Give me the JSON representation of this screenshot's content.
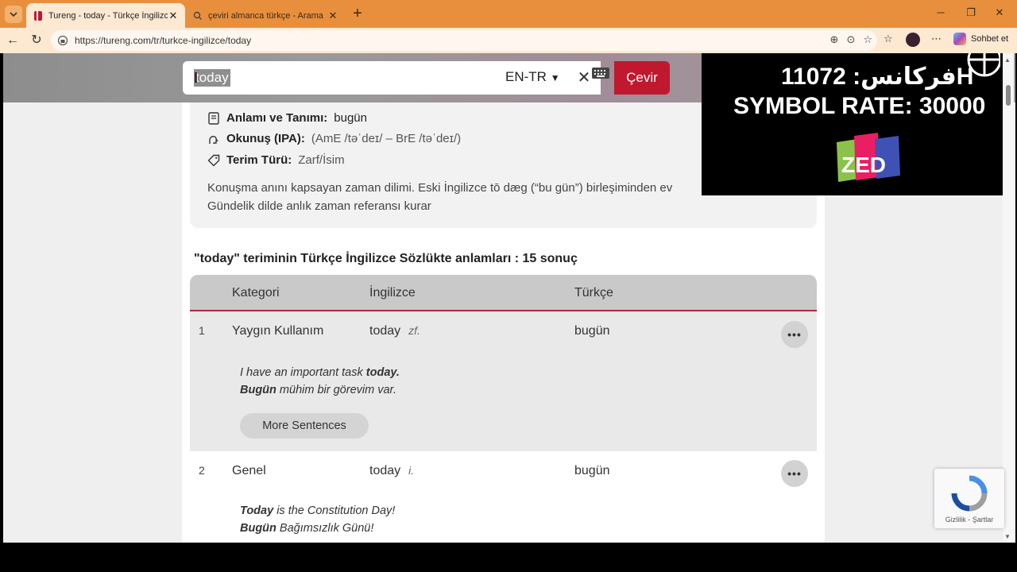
{
  "browser": {
    "tabs": [
      {
        "title": "Tureng - today - Türkçe İngilizce S",
        "active": true
      },
      {
        "title": "çeviri almanca türkçe - Arama",
        "active": false
      }
    ],
    "url": "https://tureng.com/tr/turkce-ingilizce/today",
    "copilot_label": "Sohbet et",
    "colors": {
      "tabbar": "#e88f3d",
      "toolbar": "#fde8d2"
    }
  },
  "search": {
    "query": "today",
    "language": "EN-TR",
    "submit_label": "Çevir"
  },
  "info": {
    "meaning_label": "Anlamı ve Tanımı:",
    "meaning_value": "bugün",
    "ipa_label": "Okunuş (IPA):",
    "ipa_value": "(AmE /təˈdeɪ/ – BrE /təˈdeɪ/)",
    "type_label": "Terim Türü:",
    "type_value": "Zarf/İsim",
    "description": "Konuşma anını kapsayan zaman dilimi. Eski İngilizce tō dæg (“bu gün”) birleşiminden ev",
    "description2": "Gündelik dilde anlık zaman referansı kurar"
  },
  "results": {
    "title": "\"today\" teriminin Türkçe İngilizce Sözlükte anlamları : 15 sonuç",
    "headers": {
      "category": "Kategori",
      "english": "İngilizce",
      "turkish": "Türkçe"
    },
    "rows": [
      {
        "num": "1",
        "category": "Yaygın Kullanım",
        "english": "today",
        "pos": "zf.",
        "turkish": "bugün",
        "ex_en_pre": "I have an important task ",
        "ex_en_bold": "today.",
        "ex_tr_bold": "Bugün",
        "ex_tr_rest": " mühim bir görevim var.",
        "more_sentences": "More Sentences"
      },
      {
        "num": "2",
        "category": "Genel",
        "english": "today",
        "pos": "i.",
        "turkish": "bugün",
        "ex_en_bold": "Today",
        "ex_en_rest": " is the Constitution Day!",
        "ex_tr_bold": "Bugün",
        "ex_tr_rest": " Bağımsızlık Günü!"
      }
    ]
  },
  "overlay": {
    "line1": "فركانس: 11072H",
    "line2": "SYMBOL RATE: 30000",
    "logo": "ZED"
  },
  "recaptcha": {
    "label": "Gizlilik - Şartlar"
  }
}
